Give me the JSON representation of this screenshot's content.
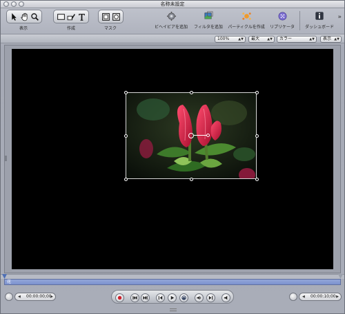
{
  "window": {
    "title": "名称未設定"
  },
  "toolbar": {
    "groups": [
      {
        "label": "表示"
      },
      {
        "label": "作成"
      },
      {
        "label": "マスク"
      }
    ],
    "tools": [
      {
        "label": "ビヘイビアを追加"
      },
      {
        "label": "フィルタを追加"
      },
      {
        "label": "パーティクルを作成"
      },
      {
        "label": "リプリケータ"
      },
      {
        "label": "ダッシュボード"
      }
    ]
  },
  "options": {
    "zoom": "100%",
    "resolution": "最大",
    "channel": "カラー",
    "view": "表示"
  },
  "timeline": {
    "layer_name": "花"
  },
  "transport": {
    "current_time": "00:00:00;00",
    "duration": "00:00:10;00"
  },
  "colors": {
    "canvas": "#000000",
    "timeline_bar": "#8397d3",
    "record": "#cc1f2a"
  }
}
